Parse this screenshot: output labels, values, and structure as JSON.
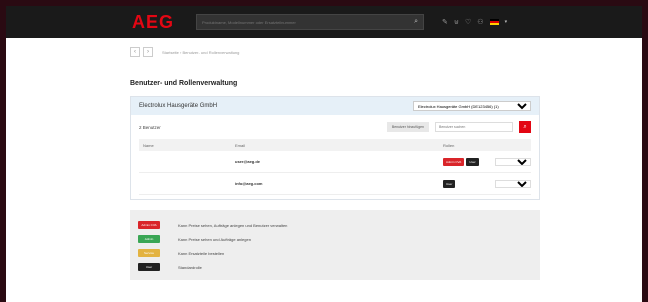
{
  "brand": "AEG",
  "search": {
    "placeholder": "Produktname, Modellnummer oder Ersatzteilnummer"
  },
  "breadcrumb": {
    "back": "‹",
    "forward": "›",
    "text": "Startseite › Benutzer- und Rollenverwaltung"
  },
  "page": {
    "title": "Benutzer- und Rollenverwaltung"
  },
  "company": {
    "name": "Electrolux Hausgeräte GmbH",
    "selector_value": "Electrolux Hausgeräte GmbH (DE123456) (1)"
  },
  "toolbar": {
    "count": "2 Benutzer",
    "add_label": "Benutzer hinzufügen",
    "filter_placeholder": "Benutzer suchen"
  },
  "table": {
    "columns": [
      "Name",
      "Email",
      "Rollen"
    ],
    "rows": [
      {
        "name": "",
        "email": "user@aeg.de",
        "roles": [
          "Admin CVA",
          "User"
        ]
      },
      {
        "name": "",
        "email": "info@aeg.com",
        "roles": [
          "User"
        ]
      }
    ]
  },
  "legend": [
    {
      "label": "Admin CVA",
      "color": "#d9252a",
      "desc": "Kann Preise sehen, Aufträge anlegen und Benutzer verwalten"
    },
    {
      "label": "Admin",
      "color": "#3aa655",
      "desc": "Kann Preise sehen und Aufträge anlegen"
    },
    {
      "label": "Service",
      "color": "#e3b341",
      "desc": "Kann Ersatzteile bestellen"
    },
    {
      "label": "User",
      "color": "#222222",
      "desc": "Standardrolle"
    }
  ],
  "colors": {
    "accent": "#e30613",
    "header": "#1a1a1a",
    "background": "#2a0a12"
  }
}
